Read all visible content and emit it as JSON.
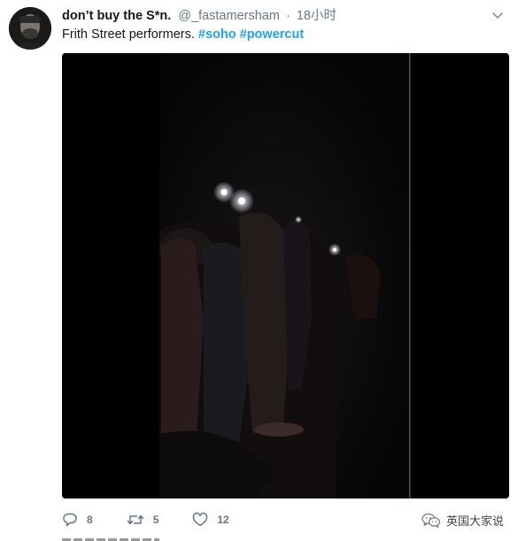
{
  "tweet": {
    "display_name": "don’t buy the S*n.",
    "handle": "@_fastamersham",
    "separator": "·",
    "time": "18小时",
    "text_plain": "Frith Street performers.",
    "hashtags": [
      "#soho",
      "#powercut"
    ],
    "avatar_icon": "user-avatar",
    "menu_icon": "chevron-down-icon"
  },
  "actions": {
    "reply": {
      "icon": "reply-icon",
      "count": "8"
    },
    "retweet": {
      "icon": "retweet-icon",
      "count": "5"
    },
    "like": {
      "icon": "heart-icon",
      "count": "12"
    }
  },
  "watermark": {
    "icon": "wechat-icon",
    "text": "英国大家说"
  },
  "colors": {
    "accent": "#1da1f2",
    "muted": "#657786",
    "text": "#14171a"
  }
}
